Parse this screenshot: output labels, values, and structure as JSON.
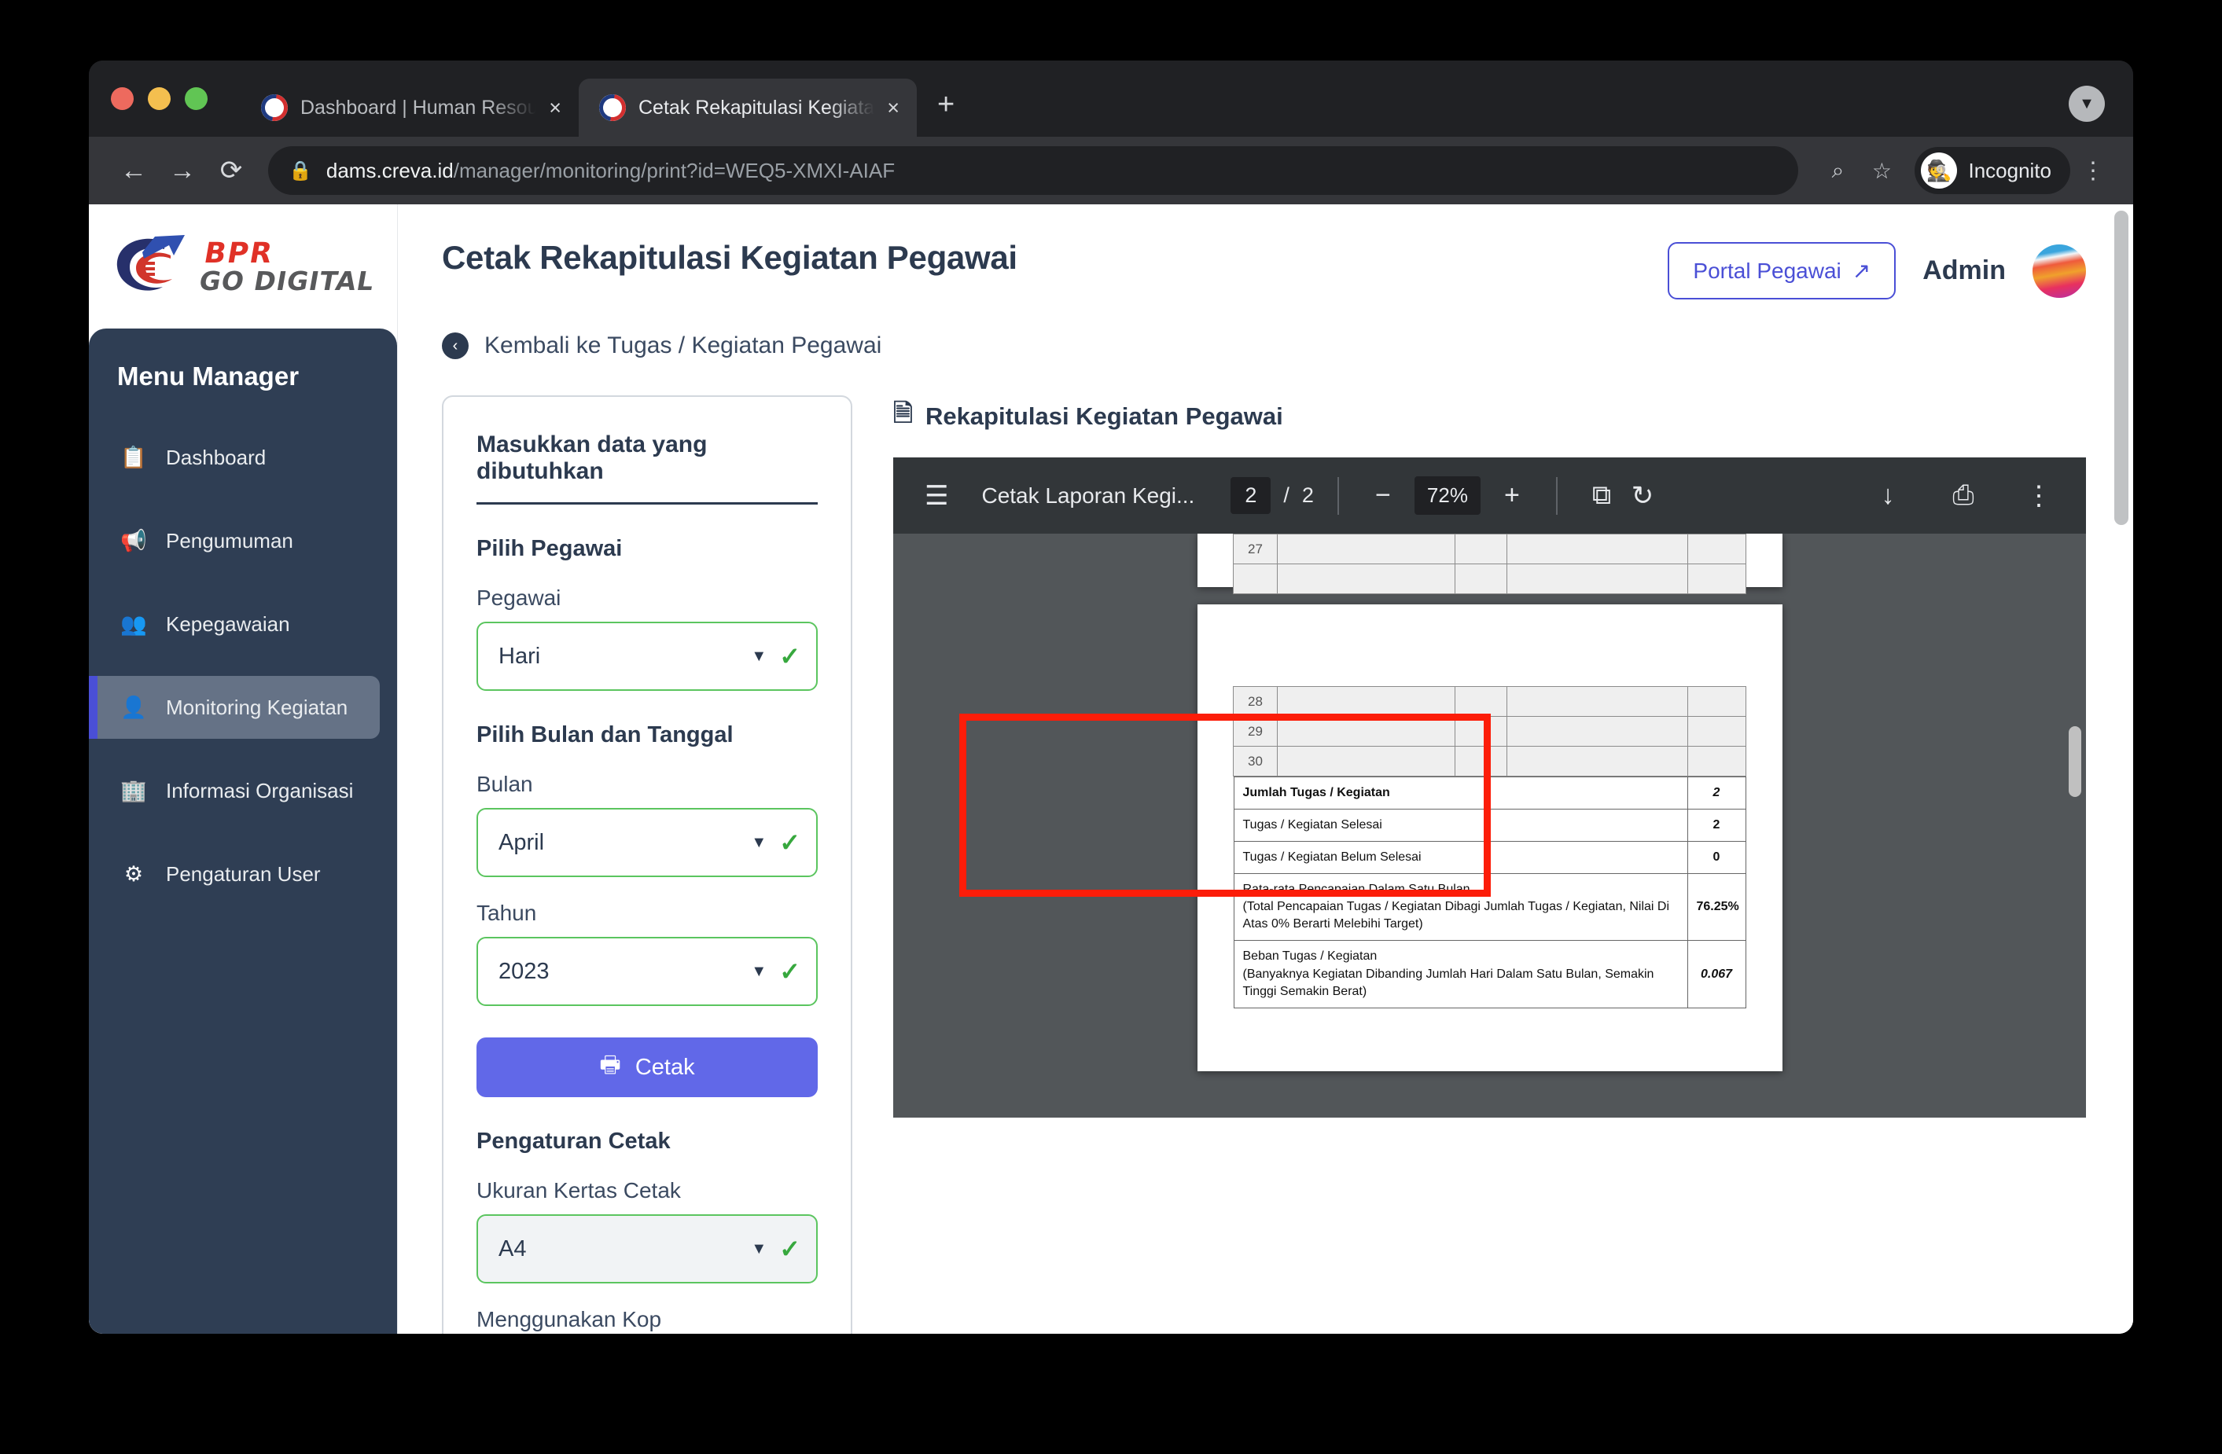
{
  "browser": {
    "tabs": [
      {
        "title": "Dashboard | Human Resource I",
        "close": "×",
        "active": false
      },
      {
        "title": "Cetak Rekapitulasi Kegiatan Pe",
        "close": "×",
        "active": true
      }
    ],
    "new_tab_label": "+",
    "window_caret": "▼",
    "nav": {
      "back": "←",
      "forward": "→",
      "reload": "⟳"
    },
    "url": {
      "lock": "🔒",
      "host": "dams.creva.id",
      "path": "/manager/monitoring/print?id=WEQ5-XMXI-AIAF"
    },
    "omni": {
      "search_icon": "⌕",
      "bookmark_icon": "☆"
    },
    "incognito": {
      "glyph": "◑",
      "label": "Incognito"
    },
    "kebab": "⋮"
  },
  "sidebar": {
    "logo": {
      "bpr": "BPR",
      "go_digital": "GO DIGITAL"
    },
    "menu_title": "Menu Manager",
    "items": [
      {
        "label": "Dashboard",
        "icon": "clipboard-icon",
        "glyph": "📋",
        "active": false
      },
      {
        "label": "Pengumuman",
        "icon": "megaphone-icon",
        "glyph": "📢",
        "active": false
      },
      {
        "label": "Kepegawaian",
        "icon": "users-icon",
        "glyph": "👥",
        "active": false
      },
      {
        "label": "Monitoring Kegiatan",
        "icon": "id-card-icon",
        "glyph": "🪪",
        "active": true
      },
      {
        "label": "Informasi Organisasi",
        "icon": "building-icon",
        "glyph": "🏢",
        "active": false
      },
      {
        "label": "Pengaturan User",
        "icon": "gear-icon",
        "glyph": "⚙",
        "active": false
      }
    ]
  },
  "header": {
    "title": "Cetak Rekapitulasi Kegiatan Pegawai",
    "portal_button": "Portal Pegawai",
    "portal_icon": "↗",
    "admin_name": "Admin",
    "back_link": "Kembali ke Tugas / Kegiatan Pegawai",
    "back_icon": "‹"
  },
  "form": {
    "card_title": "Masukkan data yang dibutuhkan",
    "section_pegawai": "Pilih Pegawai",
    "label_pegawai": "Pegawai",
    "value_pegawai": "Hari",
    "section_bulan": "Pilih Bulan dan Tanggal",
    "label_bulan": "Bulan",
    "value_bulan": "April",
    "label_tahun": "Tahun",
    "value_tahun": "2023",
    "print_button": "Cetak",
    "print_icon": "⎙",
    "section_pengaturan": "Pengaturan Cetak",
    "label_ukuran": "Ukuran Kertas Cetak",
    "value_ukuran": "A4",
    "label_kop": "Menggunakan Kop",
    "caret": "▼",
    "check": "✓"
  },
  "preview": {
    "heading": "Rekapitulasi Kegiatan Pegawai",
    "heading_icon": "🗎",
    "toolbar": {
      "hamburger": "☰",
      "doc_name": "Cetak Laporan Kegi...",
      "current_page": "2",
      "page_separator": "/",
      "total_pages": "2",
      "zoom_out": "−",
      "zoom_level": "72%",
      "zoom_in": "+",
      "fit_page_icon": "⧉",
      "rotate_icon": "↻",
      "download_icon": "↓",
      "print_icon": "⎙",
      "more_icon": "⋮"
    }
  },
  "pdf_document": {
    "page_a_rows": [
      {
        "no": "27",
        "a": "",
        "b": "",
        "c": "",
        "d": ""
      },
      {
        "no": "",
        "a": "",
        "b": "",
        "c": "",
        "d": ""
      }
    ],
    "page_b_rows": [
      {
        "no": "28",
        "a": "",
        "b": "",
        "c": "",
        "d": ""
      },
      {
        "no": "29",
        "a": "",
        "b": "",
        "c": "",
        "d": ""
      },
      {
        "no": "30",
        "a": "",
        "b": "",
        "c": "",
        "d": ""
      }
    ],
    "summary_rows": [
      {
        "label": "Jumlah Tugas / Kegiatan",
        "sub": "",
        "value": "2",
        "value_style": "v-black",
        "bold_label": true
      },
      {
        "label": "Tugas / Kegiatan Selesai",
        "sub": "",
        "value": "2",
        "value_style": "v-blue",
        "bold_label": false
      },
      {
        "label": "Tugas / Kegiatan Belum Selesai",
        "sub": "",
        "value": "0",
        "value_style": "v-red",
        "bold_label": false
      },
      {
        "label": "Rata-rata Pencapaian Dalam Satu Bulan",
        "sub": "(Total Pencapaian Tugas / Kegiatan Dibagi Jumlah Tugas / Kegiatan, Nilai Di Atas 0% Berarti Melebihi Target)",
        "value": "76.25%",
        "value_style": "v-pct",
        "bold_label": true
      },
      {
        "label": "Beban Tugas / Kegiatan",
        "sub": "(Banyaknya Kegiatan Dibanding Jumlah Hari Dalam Satu Bulan, Semakin Tinggi Semakin Berat)",
        "value": "0.067",
        "value_style": "v-black",
        "bold_label": true
      }
    ]
  },
  "colors": {
    "sidebar_bg": "#2f3e54",
    "accent_blue": "#4a4fd6",
    "button_blue": "#6168e8",
    "valid_green": "#5bc55f",
    "highlight_red": "#fc1d09",
    "pdf_toolbar": "#323639",
    "pdf_bg": "#525659"
  }
}
